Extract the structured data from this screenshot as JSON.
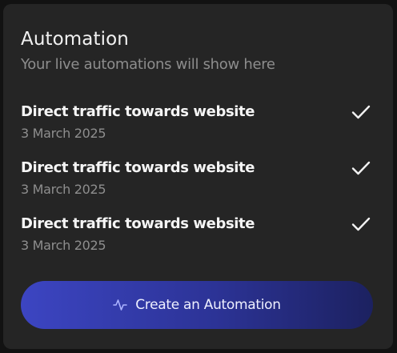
{
  "card": {
    "title": "Automation",
    "subtitle": "Your live automations will show here"
  },
  "automations": [
    {
      "title": "Direct traffic towards website",
      "date": "3 March 2025",
      "icon": "check-icon"
    },
    {
      "title": "Direct traffic towards website",
      "date": "3 March 2025",
      "icon": "check-icon"
    },
    {
      "title": "Direct traffic towards website",
      "date": "3 March 2025",
      "icon": "check-icon"
    }
  ],
  "create_button": {
    "label": "Create an Automation",
    "icon": "activity-pulse-icon"
  },
  "colors": {
    "card_bg": "#252525",
    "button_gradient_start": "#3c45c2",
    "button_gradient_end": "#1c2160"
  }
}
